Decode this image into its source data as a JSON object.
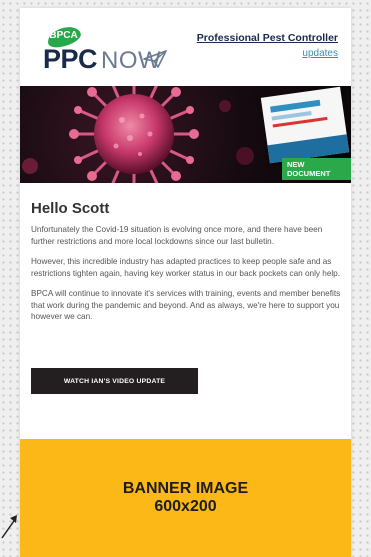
{
  "header": {
    "logo_small": "BPCA",
    "logo_ppc": "PPC",
    "logo_now": "NOW",
    "link_title": "Professional Pest Controller",
    "link_sub": "updates"
  },
  "hero": {
    "badge": "NEW DOCUMENT"
  },
  "body": {
    "greeting": "Hello Scott",
    "paragraphs": [
      "Unfortunately the Covid-19 situation is evolving once more, and there have been further restrictions and more local lockdowns since our last bulletin.",
      "However, this incredible industry has adapted practices to keep people safe and as restrictions tighten again, having key worker status in our back pockets can only help.",
      "BPCA will continue to innovate it's services with training, events and member benefits that work during the pandemic and beyond. And as always, we're here to support you however we can."
    ],
    "button_label": "WATCH IAN'S VIDEO UPDATE"
  },
  "banner": {
    "line1": "BANNER IMAGE",
    "line2": "600x200"
  },
  "colors": {
    "brand_navy": "#1a2a4a",
    "brand_green": "#27a84a",
    "banner_yellow": "#fbb816",
    "button_dark": "#231f20"
  }
}
